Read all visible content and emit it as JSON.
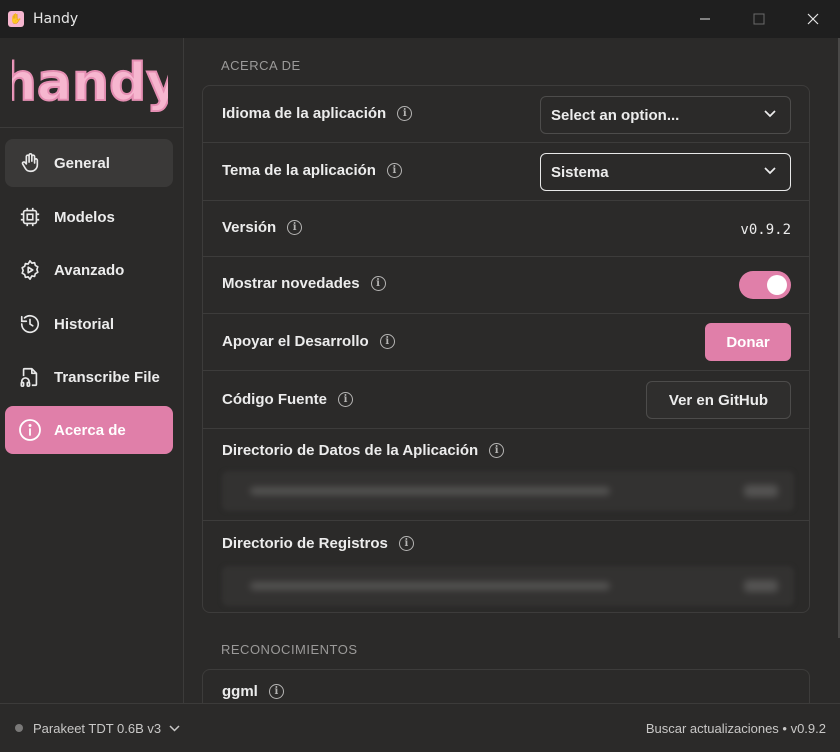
{
  "window": {
    "title": "Handy",
    "app_icon": "handy-app-icon"
  },
  "logo": {
    "text": "handy",
    "color": "#f6b6cf"
  },
  "sidebar": {
    "items": [
      {
        "label": "General",
        "icon": "hand-icon"
      },
      {
        "label": "Modelos",
        "icon": "cpu-icon"
      },
      {
        "label": "Avanzado",
        "icon": "cog-play-icon"
      },
      {
        "label": "Historial",
        "icon": "history-icon"
      },
      {
        "label": "Transcribe File",
        "icon": "file-audio-icon"
      },
      {
        "label": "Acerca de",
        "icon": "info-icon"
      }
    ],
    "active_index": 5,
    "accent": "#e07fa9"
  },
  "about": {
    "section_title": "ACERCA DE",
    "language": {
      "label": "Idioma de la aplicación",
      "value": "Select an option..."
    },
    "theme": {
      "label": "Tema de la aplicación",
      "value": "Sistema"
    },
    "version": {
      "label": "Versión",
      "value": "v0.9.2"
    },
    "show_news": {
      "label": "Mostrar novedades",
      "enabled": true
    },
    "support": {
      "label": "Apoyar el Desarrollo",
      "button": "Donar"
    },
    "source": {
      "label": "Código Fuente",
      "button": "Ver en GitHub"
    },
    "app_data_dir": {
      "label": "Directorio de Datos de la Aplicación"
    },
    "logs_dir": {
      "label": "Directorio de Registros"
    }
  },
  "acknowledgements": {
    "section_title": "RECONOCIMIENTOS",
    "first_item": "ggml"
  },
  "footer": {
    "model": "Parakeet TDT 0.6B v3",
    "updates": "Buscar actualizaciones • v0.9.2"
  }
}
